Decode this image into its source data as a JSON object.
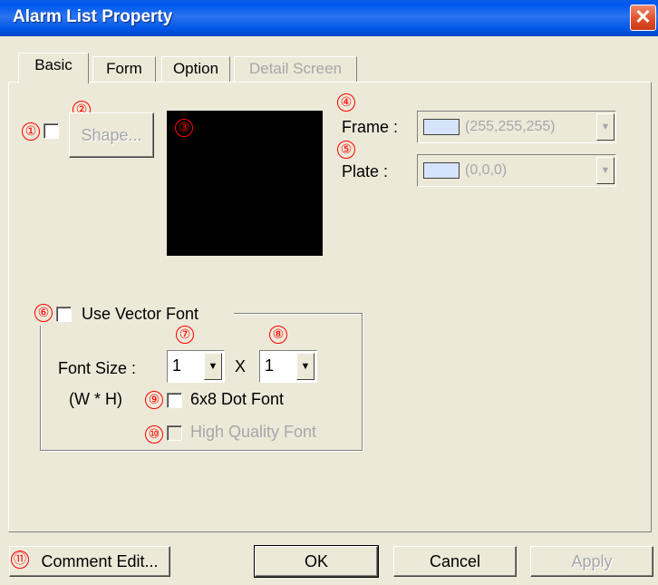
{
  "window": {
    "title": "Alarm List Property",
    "close_glyph": "✕"
  },
  "tabs": [
    {
      "label": "Basic",
      "state": "active"
    },
    {
      "label": "Form",
      "state": "normal"
    },
    {
      "label": "Option",
      "state": "normal"
    },
    {
      "label": "Detail Screen",
      "state": "disabled"
    }
  ],
  "markers": [
    "①",
    "②",
    "③",
    "④",
    "⑤",
    "⑥",
    "⑦",
    "⑧",
    "⑨",
    "⑩",
    "⑪"
  ],
  "basic": {
    "shape_button": "Shape...",
    "frame_label": "Frame :",
    "frame_value": "(255,255,255)",
    "frame_color": "#d6e4fb",
    "plate_label": "Plate :",
    "plate_value": "(0,0,0)",
    "plate_color": "#d6e4fb",
    "preview_color": "#000000",
    "use_vector_font_label": "Use Vector Font",
    "font_size_label": "Font Size :",
    "wh_label": "(W * H)",
    "font_width": "1",
    "times": "X",
    "font_height": "1",
    "dot_font_label": "6x8 Dot Font",
    "high_quality_label": "High Quality Font"
  },
  "buttons": {
    "comment_edit": "Comment Edit...",
    "ok": "OK",
    "cancel": "Cancel",
    "apply": "Apply"
  },
  "icons": {
    "dropdown": "▼"
  },
  "colors": {
    "title_bar": "#0058ee",
    "marker": "#ff0000",
    "dialog_bg": "#ece9d8"
  }
}
